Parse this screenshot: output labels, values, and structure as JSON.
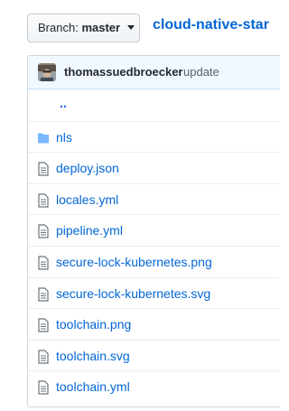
{
  "branch": {
    "prefix": "Branch:",
    "name": "master"
  },
  "breadcrumb": {
    "repo": "cloud-native-star"
  },
  "commit": {
    "author": "thomassuedbroecker",
    "message": "update"
  },
  "parent_link": "..",
  "files": [
    {
      "name": "nls",
      "type": "folder"
    },
    {
      "name": "deploy.json",
      "type": "file"
    },
    {
      "name": "locales.yml",
      "type": "file"
    },
    {
      "name": "pipeline.yml",
      "type": "file"
    },
    {
      "name": "secure-lock-kubernetes.png",
      "type": "file"
    },
    {
      "name": "secure-lock-kubernetes.svg",
      "type": "file"
    },
    {
      "name": "toolchain.png",
      "type": "file"
    },
    {
      "name": "toolchain.svg",
      "type": "file"
    },
    {
      "name": "toolchain.yml",
      "type": "file"
    }
  ],
  "colors": {
    "link": "#0366d6",
    "folder_icon": "#79b8ff",
    "file_icon": "#6a737d",
    "commit_bar": "#f1f8ff"
  },
  "icons": {
    "folder": "folder-icon",
    "file": "file-icon",
    "caret": "caret-down-icon"
  }
}
